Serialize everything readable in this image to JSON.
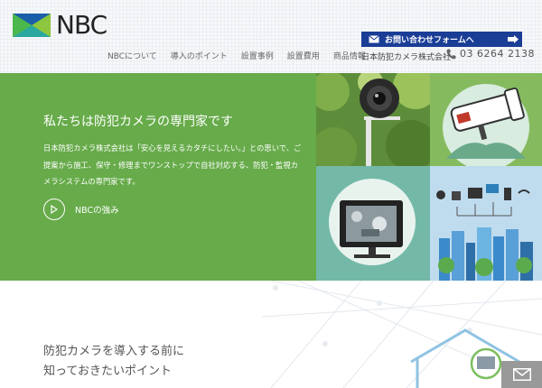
{
  "header": {
    "logo_text": "NBC",
    "nav": [
      {
        "label": "NBCについて"
      },
      {
        "label": "導入のポイント"
      },
      {
        "label": "設置事例"
      },
      {
        "label": "設置費用"
      },
      {
        "label": "商品情報"
      }
    ],
    "contact_button": "お問い合わせフォームへ",
    "company_name": "日本防犯カメラ株式会社",
    "phone": "03 6264 2138"
  },
  "hero": {
    "title": "私たちは防犯カメラの専門家です",
    "description": "日本防犯カメラ株式会社は「安心を見えるカタチにしたい。」との思いで、ご提案から施工、保守・修理までワンストップで自社対応する、防犯・監視カメラシステムの専門家です。",
    "strength_link": "NBCの強み"
  },
  "section": {
    "heading_line1": "防犯カメラを導入する前に",
    "heading_line2": "知っておきたいポイント"
  },
  "colors": {
    "hero_green": "#67ab4a",
    "contact_blue": "#1a3d96",
    "logo_blue": "#1b5fa8",
    "logo_green": "#4bb84e"
  }
}
